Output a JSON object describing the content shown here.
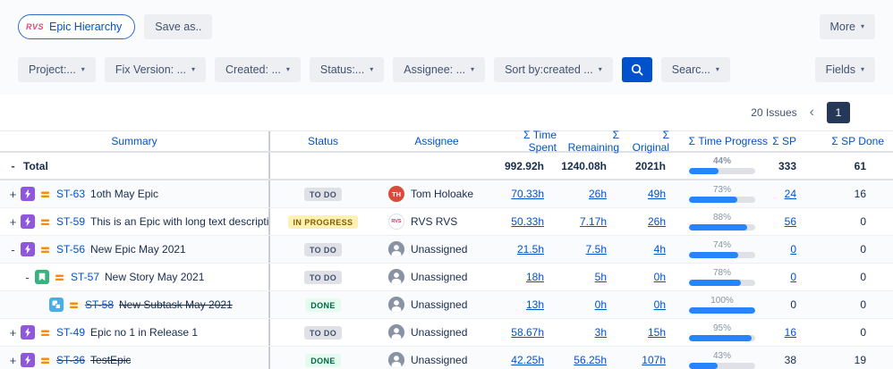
{
  "colors": {
    "accent_blue": "#0052CC",
    "progress_fill": "#2684FF",
    "epic_purple": "#8F57DB",
    "story_green": "#36B37E",
    "subtask_blue": "#4BADE8",
    "priority_orange": "#FF8B00",
    "status_todo_bg": "#DFE1E6",
    "status_inprogress_bg": "#FFF0B3",
    "status_done_bg": "#E3FCEF",
    "page_box_navy": "#253858"
  },
  "toolbar": {
    "app_logo": "RVS",
    "app_button_label": "Epic Hierarchy",
    "save_as_label": "Save as..",
    "more_label": "More"
  },
  "filters": {
    "items": [
      {
        "label": "Project:..."
      },
      {
        "label": "Fix Version: ..."
      },
      {
        "label": "Created: ..."
      },
      {
        "label": "Status:..."
      },
      {
        "label": "Assignee: ..."
      },
      {
        "label": "Sort by:created ..."
      }
    ],
    "search_dropdown_label": "Searc...",
    "fields_label": "Fields"
  },
  "pagination": {
    "count_label": "20 Issues",
    "prev_icon": "‹",
    "current_page": "1"
  },
  "table": {
    "columns": [
      "Summary",
      "Status",
      "Assignee",
      "Σ Time Spent",
      "Σ Remaining",
      "Σ Original",
      "Σ Time Progress",
      "Σ SP",
      "Σ SP Done"
    ],
    "total": {
      "expander": "-",
      "label": "Total",
      "time_spent": "992.92h",
      "remaining": "1240.08h",
      "original": "2021h",
      "progress_pct": 44,
      "sp": "333",
      "sp_done": "61"
    },
    "rows": [
      {
        "expander": "+",
        "indent": 0,
        "type": "epic",
        "key": "ST-63",
        "summary": "1oth May Epic",
        "struck": false,
        "status": "TO DO",
        "status_type": "todo",
        "assignee": "Tom Holoake",
        "avatar": {
          "kind": "initials",
          "text": "TH",
          "bg": "#D94C3D",
          "fg": "#FFFFFF"
        },
        "time_spent": "70.33h",
        "remaining": "26h",
        "original": "49h",
        "progress_pct": 73,
        "sp": "24",
        "sp_link": true,
        "sp_done": "16"
      },
      {
        "expander": "+",
        "indent": 0,
        "type": "epic",
        "key": "ST-59",
        "summary": "This is an Epic with long text description",
        "struck": false,
        "status": "IN PROGRESS",
        "status_type": "inprogress",
        "assignee": "RVS RVS",
        "avatar": {
          "kind": "initials",
          "text": "RVS",
          "bg": "#FFFFFF",
          "fg": "#D6336C",
          "border": "#DFE1E6"
        },
        "time_spent": "50.33h",
        "remaining": "7.17h",
        "original": "26h",
        "progress_pct": 88,
        "sp": "56",
        "sp_link": true,
        "sp_done": "0"
      },
      {
        "expander": "-",
        "indent": 0,
        "type": "epic",
        "key": "ST-56",
        "summary": "New Epic May 2021",
        "struck": false,
        "status": "TO DO",
        "status_type": "todo",
        "assignee": "Unassigned",
        "avatar": {
          "kind": "unassigned"
        },
        "time_spent": "21.5h",
        "remaining": "7.5h",
        "original": "4h",
        "progress_pct": 74,
        "sp": "0",
        "sp_link": true,
        "sp_done": "0"
      },
      {
        "expander": "-",
        "indent": 1,
        "type": "story",
        "key": "ST-57",
        "summary": "New Story May 2021",
        "struck": false,
        "status": "TO DO",
        "status_type": "todo",
        "assignee": "Unassigned",
        "avatar": {
          "kind": "unassigned"
        },
        "time_spent": "18h",
        "remaining": "5h",
        "original": "0h",
        "progress_pct": 78,
        "sp": "0",
        "sp_link": true,
        "sp_done": "0"
      },
      {
        "expander": "",
        "indent": 2,
        "type": "subtask",
        "key": "ST-58",
        "summary": "New Subtask May 2021",
        "struck": true,
        "status": "DONE",
        "status_type": "done",
        "assignee": "Unassigned",
        "avatar": {
          "kind": "unassigned"
        },
        "time_spent": "13h",
        "remaining": "0h",
        "original": "0h",
        "progress_pct": 100,
        "sp": "0",
        "sp_link": false,
        "sp_done": "0"
      },
      {
        "expander": "+",
        "indent": 0,
        "type": "epic",
        "key": "ST-49",
        "summary": "Epic no 1 in Release 1",
        "struck": false,
        "status": "TO DO",
        "status_type": "todo",
        "assignee": "Unassigned",
        "avatar": {
          "kind": "unassigned"
        },
        "time_spent": "58.67h",
        "remaining": "3h",
        "original": "15h",
        "progress_pct": 95,
        "sp": "16",
        "sp_link": true,
        "sp_done": "0"
      },
      {
        "expander": "+",
        "indent": 0,
        "type": "epic",
        "key": "ST-36",
        "summary": "TestEpic",
        "struck": true,
        "status": "DONE",
        "status_type": "done",
        "assignee": "Unassigned",
        "avatar": {
          "kind": "unassigned"
        },
        "time_spent": "42.25h",
        "remaining": "56.25h",
        "original": "107h",
        "progress_pct": 43,
        "sp": "38",
        "sp_link": false,
        "sp_done": "19"
      }
    ]
  }
}
